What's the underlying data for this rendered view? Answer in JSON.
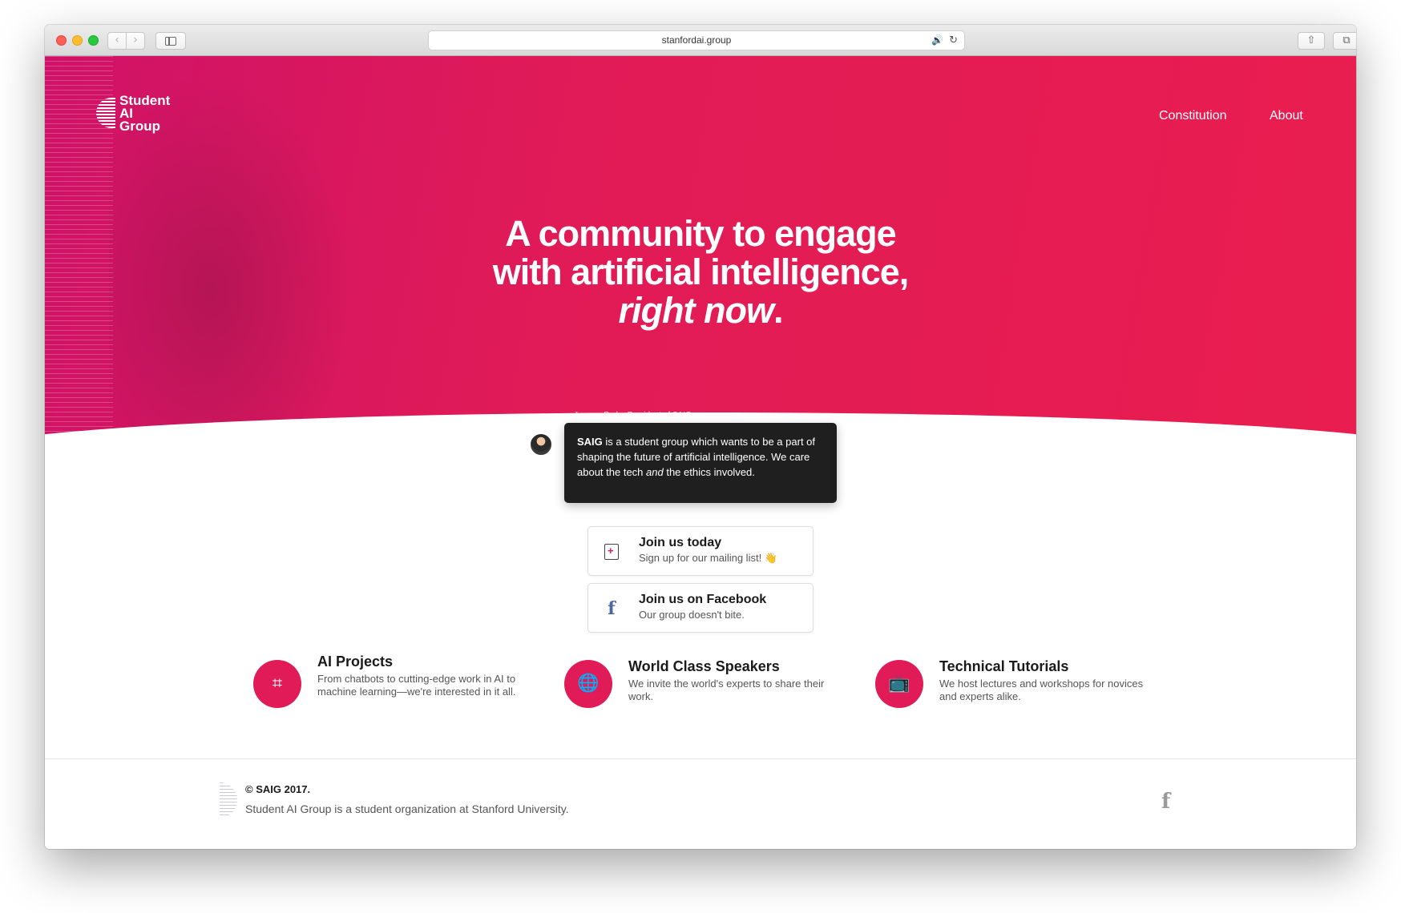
{
  "browser": {
    "url": "stanfordai.group",
    "back_icon": "‹",
    "forward_icon": "›",
    "speaker_icon": "🔊",
    "reload_icon": "↻",
    "share_icon": "⇧",
    "tabs_icon": "⧉",
    "new_tab_icon": "+"
  },
  "header": {
    "logo_lines": [
      "Student",
      "AI",
      "Group"
    ],
    "nav": [
      {
        "label": "Constitution"
      },
      {
        "label": "About"
      }
    ]
  },
  "hero": {
    "headline_line1": "A community to engage",
    "headline_line2": "with artificial intelligence,",
    "headline_em": "right now",
    "headline_end": ".",
    "quote_meta": "Junwon Park · President of SAIG",
    "quote_strong": "SAIG",
    "quote_part1": " is a student group which wants to be a part of shaping the future of artificial intelligence. We care about the tech ",
    "quote_em": "and",
    "quote_part2": " the ethics involved."
  },
  "cta": [
    {
      "title": "Join us today",
      "subtitle": "Sign up for our mailing list! 👋",
      "icon": "document-plus-icon"
    },
    {
      "title": "Join us on Facebook",
      "subtitle": "Our group doesn't bite.",
      "icon": "facebook-icon",
      "glyph": "f"
    }
  ],
  "features": [
    {
      "title": "AI Projects",
      "body": "From chatbots to cutting-edge work in AI to machine learning—we're interested in it all.",
      "icon": "chip-icon",
      "glyph": "⌗"
    },
    {
      "title": "World Class Speakers",
      "body": "We invite the world's experts to share their work.",
      "icon": "globe-icon",
      "glyph": "🌐"
    },
    {
      "title": "Technical Tutorials",
      "body": "We host lectures and workshops for novices and experts alike.",
      "icon": "tv-icon",
      "glyph": "📺"
    }
  ],
  "footer": {
    "copyright": "© SAIG 2017.",
    "description": "Student AI Group is a student organization at Stanford University.",
    "facebook_glyph": "f"
  },
  "colors": {
    "brand": "#e11b57",
    "brand_deep": "#cf1268",
    "bubble": "#1f1f1f"
  }
}
